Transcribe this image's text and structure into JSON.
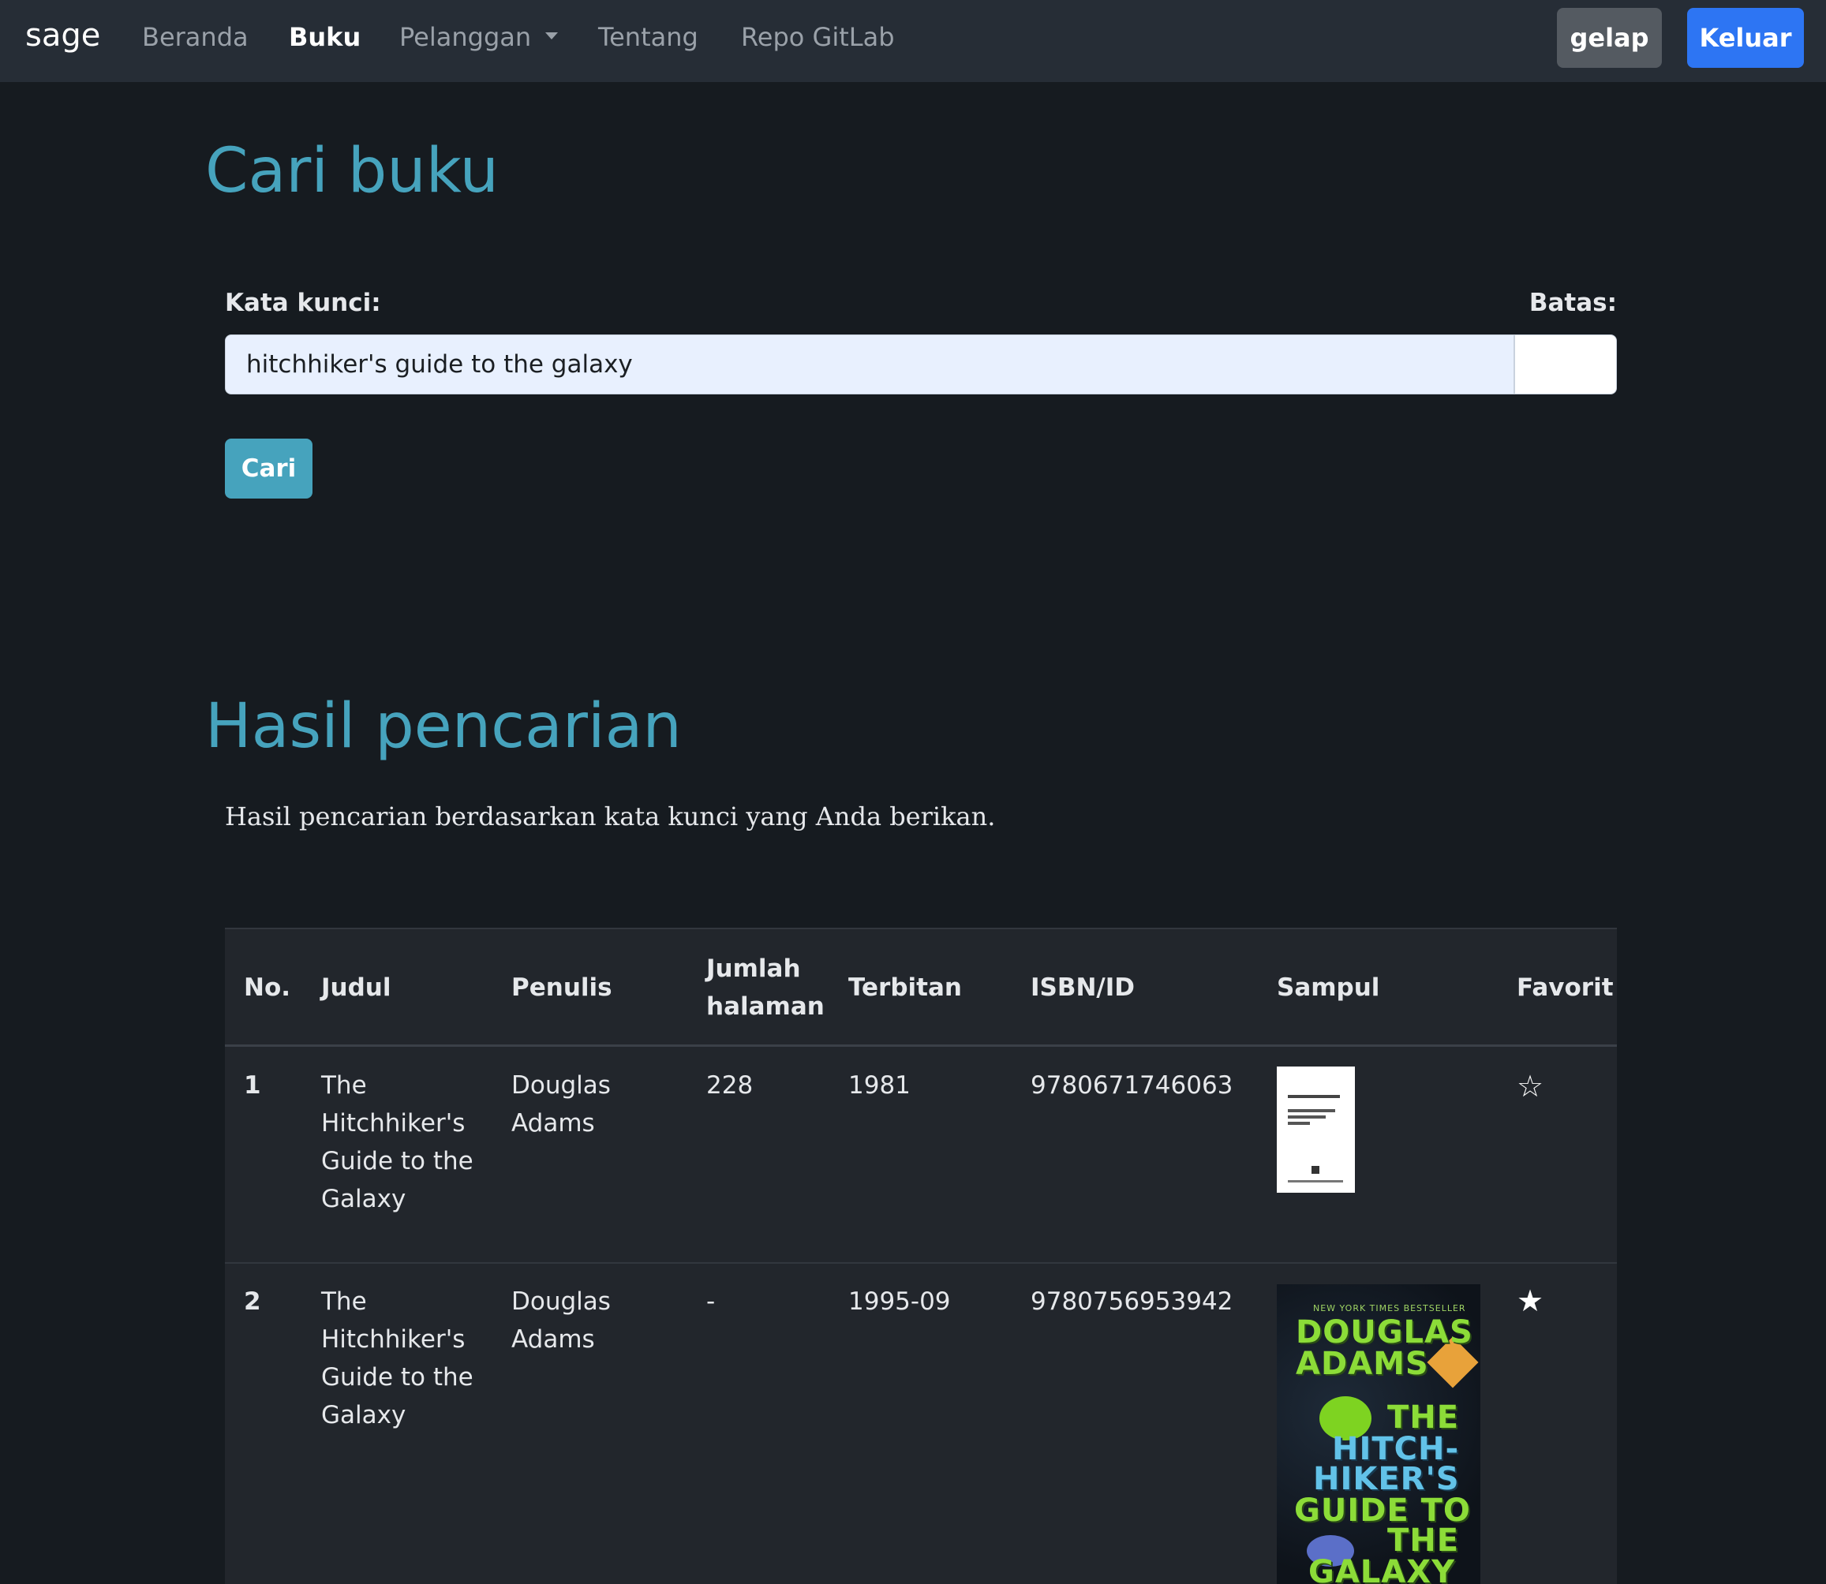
{
  "nav": {
    "brand": "sage",
    "items": [
      {
        "label": "Beranda"
      },
      {
        "label": "Buku"
      },
      {
        "label": "Pelanggan"
      },
      {
        "label": "Tentang"
      },
      {
        "label": "Repo GitLab"
      }
    ],
    "theme_button": "gelap",
    "logout_button": "Keluar"
  },
  "search": {
    "title": "Cari buku",
    "keyword_label": "Kata kunci:",
    "limit_label": "Batas:",
    "keyword_value": "hitchhiker's guide to the galaxy",
    "limit_value": "",
    "submit_label": "Cari"
  },
  "results": {
    "title": "Hasil pencarian",
    "description": "Hasil pencarian berdasarkan kata kunci yang Anda berikan.",
    "columns": {
      "no": "No.",
      "title": "Judul",
      "author": "Penulis",
      "pages_line1": "Jumlah",
      "pages_line2": "halaman",
      "published": "Terbitan",
      "isbn": "ISBN/ID",
      "cover": "Sampul",
      "favorite": "Favorit"
    },
    "rows": [
      {
        "no": "1",
        "title_lines": [
          "The",
          "Hitchhiker's",
          "Guide to the",
          "Galaxy"
        ],
        "author_lines": [
          "Douglas",
          "Adams"
        ],
        "pages": "228",
        "published": "1981",
        "isbn": "9780671746063",
        "favorite": false,
        "favorite_icon": "star-outline-icon"
      },
      {
        "no": "2",
        "title_lines": [
          "The",
          "Hitchhiker's",
          "Guide to the",
          "Galaxy"
        ],
        "author_lines": [
          "Douglas",
          "Adams"
        ],
        "pages": "-",
        "published": "1995-09",
        "isbn": "9780756953942",
        "favorite": true,
        "favorite_icon": "star-filled-icon"
      }
    ],
    "cover2_text": {
      "tagline": "NEW YORK TIMES BESTSELLER",
      "line1": "DOUGLAS",
      "line2": "ADAMS",
      "line3": "THE",
      "line4": "HITCH-",
      "line5": "HIKER'S",
      "line6": "GUIDE TO",
      "line7": "THE",
      "line8": "GALAXY"
    }
  },
  "colors": {
    "accent": "#46a3bd",
    "navbar": "#262d36",
    "background": "#161b20",
    "primary": "#2d75f3"
  }
}
